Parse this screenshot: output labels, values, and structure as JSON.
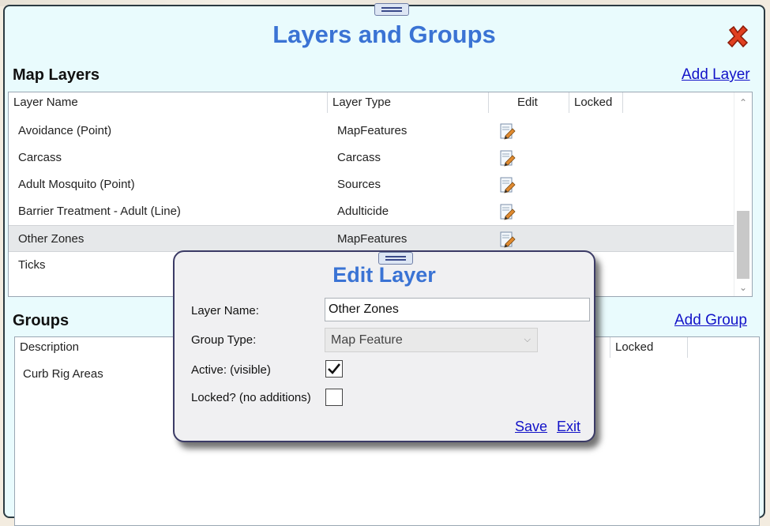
{
  "window": {
    "title": "Layers and Groups"
  },
  "map_layers": {
    "heading": "Map Layers",
    "add_link": "Add Layer",
    "columns": [
      "Layer Name",
      "Layer Type",
      "Edit",
      "Locked"
    ],
    "rows": [
      {
        "name": "Avoidance (Point)",
        "type": "MapFeatures",
        "edit_icon": "edit-document-icon"
      },
      {
        "name": "Carcass",
        "type": "Carcass",
        "edit_icon": "edit-document-icon"
      },
      {
        "name": "Adult Mosquito (Point)",
        "type": "Sources",
        "edit_icon": "edit-document-icon"
      },
      {
        "name": "Barrier Treatment - Adult (Line)",
        "type": "Adulticide",
        "edit_icon": "edit-document-icon"
      },
      {
        "name": "Other Zones",
        "type": "MapFeatures",
        "edit_icon": "edit-document-icon",
        "selected": true
      },
      {
        "name": "Ticks",
        "type": "",
        "edit_icon": "edit-document-icon"
      }
    ]
  },
  "groups": {
    "heading": "Groups",
    "add_link": "Add Group",
    "columns": [
      "Description",
      "Locked"
    ],
    "rows": [
      {
        "description": "Curb Rig Areas"
      }
    ]
  },
  "edit_layer_dialog": {
    "title": "Edit Layer",
    "layer_name_label": "Layer Name:",
    "layer_name_value": "Other Zones",
    "group_type_label": "Group Type:",
    "group_type_value": "Map Feature",
    "active_label": "Active: (visible)",
    "active_checked": true,
    "locked_label": "Locked? (no additions)",
    "locked_checked": false,
    "save_label": "Save",
    "exit_label": "Exit"
  },
  "colors": {
    "title": "#3a73d4",
    "link": "#1212c8",
    "panel_bg": "#e9fbfd",
    "close": "#e04020"
  }
}
